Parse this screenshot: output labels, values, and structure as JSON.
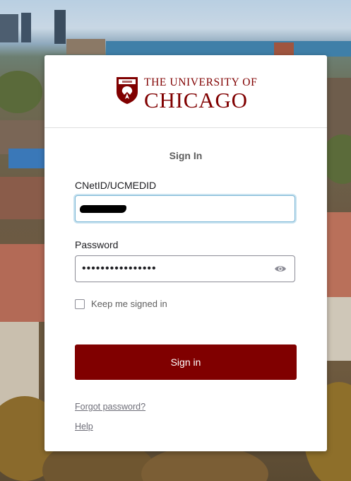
{
  "logo": {
    "line1": "THE UNIVERSITY OF",
    "line2": "CHICAGO",
    "brand_color": "#800000"
  },
  "form": {
    "title": "Sign In",
    "username": {
      "label": "CNetID/UCMEDID",
      "value": "",
      "redacted": true
    },
    "password": {
      "label": "Password",
      "masked_value": "••••••••••••••••",
      "toggle_icon": "eye-icon"
    },
    "remember": {
      "label": "Keep me signed in",
      "checked": false
    },
    "submit_label": "Sign in"
  },
  "links": {
    "forgot_password": "Forgot password?",
    "help": "Help"
  },
  "colors": {
    "primary_button": "#800000",
    "focus_border": "#7cb7d6"
  }
}
